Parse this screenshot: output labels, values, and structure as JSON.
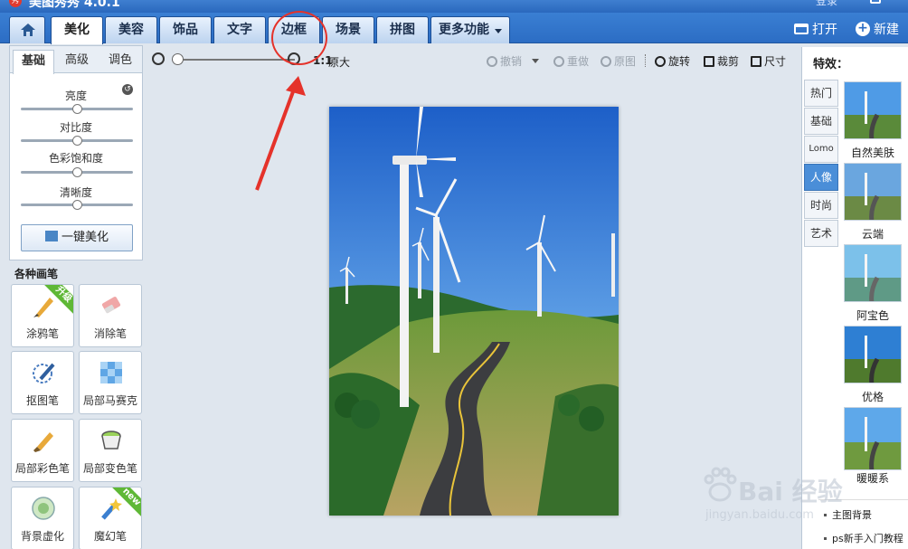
{
  "app": {
    "title": "美图秀秀 4.0.1",
    "logo_text": "秀",
    "login": "登录"
  },
  "nav": {
    "tabs": [
      "美化",
      "美容",
      "饰品",
      "文字",
      "边框",
      "场景",
      "拼图"
    ],
    "active_tab": "美化",
    "more": "更多功能",
    "open": "打开",
    "new": "新建"
  },
  "adjust": {
    "tabs": [
      "基础",
      "高级",
      "调色"
    ],
    "active_tab": "基础",
    "sliders": [
      {
        "label": "亮度",
        "level": 0.5
      },
      {
        "label": "对比度",
        "level": 0.5
      },
      {
        "label": "色彩饱和度",
        "level": 0.5
      },
      {
        "label": "清晰度",
        "level": 0.5
      }
    ],
    "one_key": "一键美化"
  },
  "brushes": {
    "header": "各种画笔",
    "items": [
      {
        "label": "涂鸦笔",
        "badge": "升级",
        "icon": "pencil-brush-icon"
      },
      {
        "label": "消除笔",
        "badge": "",
        "icon": "eraser-icon"
      },
      {
        "label": "抠图笔",
        "badge": "",
        "icon": "cutout-pen-icon"
      },
      {
        "label": "局部马赛克",
        "badge": "",
        "icon": "mosaic-icon"
      },
      {
        "label": "局部彩色笔",
        "badge": "",
        "icon": "color-brush-icon"
      },
      {
        "label": "局部变色笔",
        "badge": "",
        "icon": "recolor-bucket-icon"
      },
      {
        "label": "背景虚化",
        "badge": "",
        "icon": "blur-icon"
      },
      {
        "label": "魔幻笔",
        "badge": "new",
        "icon": "magic-wand-icon"
      }
    ]
  },
  "toolbar": {
    "ratio_icon": "1:1",
    "original_size": "原大",
    "zoom_level": 0.0,
    "undo": "撤销",
    "redo": "重做",
    "original": "原图",
    "rotate": "旋转",
    "crop": "裁剪",
    "size": "尺寸"
  },
  "effects": {
    "title": "特效：",
    "categories": [
      "热门",
      "基础",
      "Lomo",
      "人像",
      "时尚",
      "艺术"
    ],
    "active_category": "人像",
    "items": [
      "自然美肤",
      "云端",
      "阿宝色",
      "优格",
      "暖暖系"
    ]
  },
  "links": [
    "主图背景",
    "ps新手入门教程"
  ],
  "watermark": {
    "text": "Bai 经验",
    "sub": "jingyan.baidu.com"
  },
  "colors": {
    "annotation": "#e5322a",
    "nav_bg": "#2c6dc4",
    "active_effect": "#4a8ed8"
  }
}
